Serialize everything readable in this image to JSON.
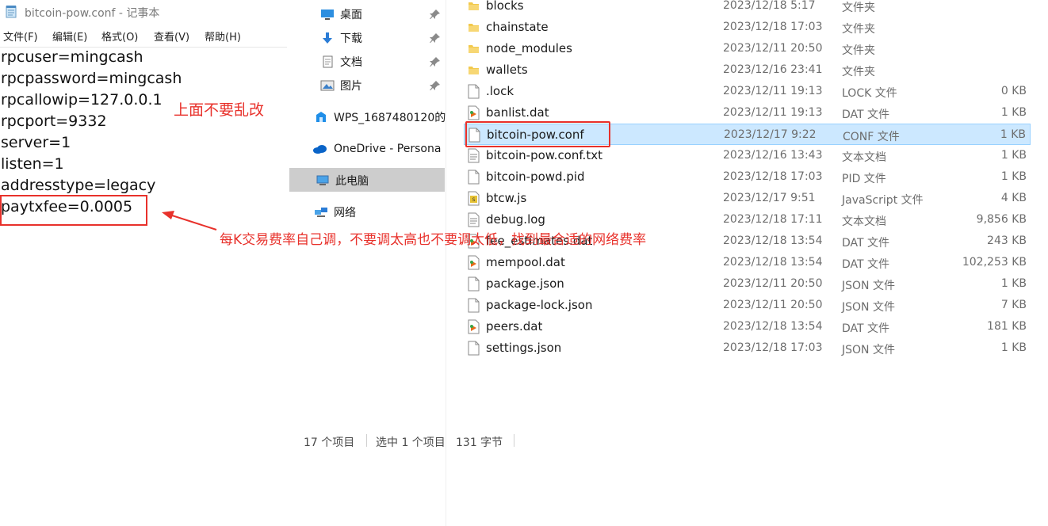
{
  "notepad": {
    "title": "bitcoin-pow.conf - 记事本",
    "menu": [
      "文件(F)",
      "编辑(E)",
      "格式(O)",
      "查看(V)",
      "帮助(H)"
    ],
    "lines": [
      "rpcuser=mingcash",
      "rpcpassword=mingcash",
      "rpcallowip=127.0.0.1",
      "rpcport=9332",
      "server=1",
      "listen=1",
      "addresstype=legacy",
      "paytxfee=0.0005"
    ]
  },
  "annotations": {
    "top": "上面不要乱改",
    "bottom": "每K交易费率自己调，不要调太高也不要调太低，找到最合适的网络费率",
    "color": "#e8312b"
  },
  "nav": {
    "quick_access": [
      {
        "label": "桌面",
        "icon": "desktop-icon"
      },
      {
        "label": "下载",
        "icon": "download-arrow-icon"
      },
      {
        "label": "文档",
        "icon": "document-icon"
      },
      {
        "label": "图片",
        "icon": "picture-icon"
      }
    ],
    "wps": "WPS_1687480120的",
    "onedrive": "OneDrive - Persona",
    "this_pc": "此电脑",
    "network": "网络"
  },
  "files": [
    {
      "name": "blocks",
      "date": "2023/12/18 5:17",
      "type": "文件夹",
      "size": "",
      "icon": "folder"
    },
    {
      "name": "chainstate",
      "date": "2023/12/18 17:03",
      "type": "文件夹",
      "size": "",
      "icon": "folder"
    },
    {
      "name": "node_modules",
      "date": "2023/12/11 20:50",
      "type": "文件夹",
      "size": "",
      "icon": "folder"
    },
    {
      "name": "wallets",
      "date": "2023/12/16 23:41",
      "type": "文件夹",
      "size": "",
      "icon": "folder"
    },
    {
      "name": ".lock",
      "date": "2023/12/11 19:13",
      "type": "LOCK 文件",
      "size": "0 KB",
      "icon": "file"
    },
    {
      "name": "banlist.dat",
      "date": "2023/12/11 19:13",
      "type": "DAT 文件",
      "size": "1 KB",
      "icon": "media"
    },
    {
      "name": "bitcoin-pow.conf",
      "date": "2023/12/17 9:22",
      "type": "CONF 文件",
      "size": "1 KB",
      "icon": "file",
      "selected": true
    },
    {
      "name": "bitcoin-pow.conf.txt",
      "date": "2023/12/16 13:43",
      "type": "文本文档",
      "size": "1 KB",
      "icon": "text"
    },
    {
      "name": "bitcoin-powd.pid",
      "date": "2023/12/18 17:03",
      "type": "PID 文件",
      "size": "1 KB",
      "icon": "file"
    },
    {
      "name": "btcw.js",
      "date": "2023/12/17 9:51",
      "type": "JavaScript 文件",
      "size": "4 KB",
      "icon": "js"
    },
    {
      "name": "debug.log",
      "date": "2023/12/18 17:11",
      "type": "文本文档",
      "size": "9,856 KB",
      "icon": "text"
    },
    {
      "name": "fee_estimates.dat",
      "date": "2023/12/18 13:54",
      "type": "DAT 文件",
      "size": "243 KB",
      "icon": "media"
    },
    {
      "name": "mempool.dat",
      "date": "2023/12/18 13:54",
      "type": "DAT 文件",
      "size": "102,253 KB",
      "icon": "media"
    },
    {
      "name": "package.json",
      "date": "2023/12/11 20:50",
      "type": "JSON 文件",
      "size": "1 KB",
      "icon": "file"
    },
    {
      "name": "package-lock.json",
      "date": "2023/12/11 20:50",
      "type": "JSON 文件",
      "size": "7 KB",
      "icon": "file"
    },
    {
      "name": "peers.dat",
      "date": "2023/12/18 13:54",
      "type": "DAT 文件",
      "size": "181 KB",
      "icon": "media"
    },
    {
      "name": "settings.json",
      "date": "2023/12/18 17:03",
      "type": "JSON 文件",
      "size": "1 KB",
      "icon": "file"
    }
  ],
  "status": {
    "count": "17 个项目",
    "selection": "选中 1 个项目",
    "bytes": "131 字节"
  }
}
